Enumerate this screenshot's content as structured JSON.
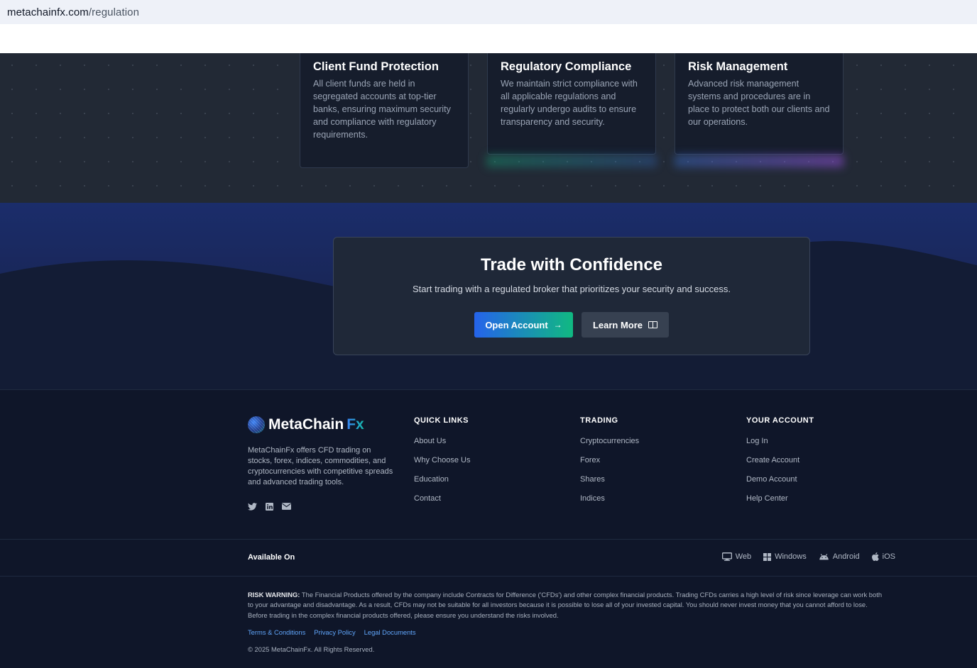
{
  "browser": {
    "url_domain": "metachainfx.com",
    "url_path": "/regulation"
  },
  "features": [
    {
      "title": "Client Fund Protection",
      "text": "All client funds are held in segregated accounts at top-tier banks, ensuring maximum security and compliance with regulatory requirements.",
      "icon": "wallet-icon",
      "accent": "#1e3a8a"
    },
    {
      "title": "Regulatory Compliance",
      "text": "We maintain strict compliance with all applicable regulations and regularly undergo audits to ensure transparency and security.",
      "icon": "shield-icon",
      "accent": "#064e3b"
    },
    {
      "title": "Risk Management",
      "text": "Advanced risk management systems and procedures are in place to protect both our clients and our operations.",
      "icon": "chart-icon",
      "accent": "#4c1d95"
    }
  ],
  "cta": {
    "title": "Trade with Confidence",
    "subtitle": "Start trading with a regulated broker that prioritizes your security and success.",
    "primary_label": "Open Account",
    "secondary_label": "Learn More"
  },
  "footer": {
    "brand_name": "MetaChain",
    "brand_suffix": "Fx",
    "description": "MetaChainFx offers CFD trading on stocks, forex, indices, commodities, and cryptocurrencies with competitive spreads and advanced trading tools.",
    "socials": [
      "twitter-icon",
      "linkedin-icon",
      "mail-icon"
    ],
    "columns": [
      {
        "heading": "QUICK LINKS",
        "links": [
          "About Us",
          "Why Choose Us",
          "Education",
          "Contact"
        ]
      },
      {
        "heading": "TRADING",
        "links": [
          "Cryptocurrencies",
          "Forex",
          "Shares",
          "Indices"
        ]
      },
      {
        "heading": "YOUR ACCOUNT",
        "links": [
          "Log In",
          "Create Account",
          "Demo Account",
          "Help Center"
        ]
      }
    ],
    "available_label": "Available On",
    "platforms": [
      {
        "label": "Web",
        "icon": "monitor-icon"
      },
      {
        "label": "Windows",
        "icon": "windows-icon"
      },
      {
        "label": "Android",
        "icon": "android-icon"
      },
      {
        "label": "iOS",
        "icon": "apple-icon"
      }
    ],
    "risk_label": "RISK WARNING:",
    "risk_text": "The Financial Products offered by the company include Contracts for Difference ('CFDs') and other complex financial products. Trading CFDs carries a high level of risk since leverage can work both to your advantage and disadvantage. As a result, CFDs may not be suitable for all investors because it is possible to lose all of your invested capital. You should never invest money that you cannot afford to lose. Before trading in the complex financial products offered, please ensure you understand the risks involved.",
    "legal_links": [
      "Terms & Conditions",
      "Privacy Policy",
      "Legal Documents"
    ],
    "copyright": "© 2025 MetaChainFx. All Rights Reserved."
  }
}
